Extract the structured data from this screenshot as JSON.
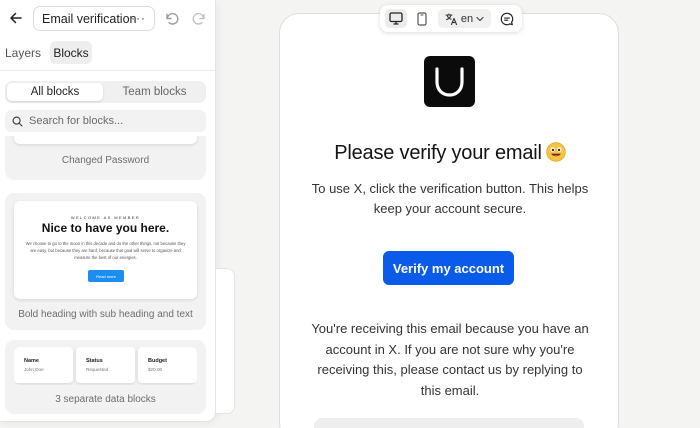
{
  "editor": {
    "document_title": "Email verification",
    "more_label": "···",
    "tabs": [
      "Layers",
      "Blocks"
    ],
    "active_tab": "Blocks",
    "block_filter": {
      "options": [
        "All blocks",
        "Team blocks"
      ],
      "selected": "All blocks"
    },
    "search": {
      "placeholder": "Search for blocks...",
      "value": ""
    },
    "blocks": [
      {
        "label": "Changed Password"
      },
      {
        "label": "Bold heading with sub heading and text",
        "preview": {
          "eyebrow": "WELCOME AS MEMBER",
          "heading": "Nice to have you here.",
          "text": "We choose to go to the moon in this decade and do the other things, not because they are easy, but because they are hard, because that goal will serve to organize and measure the best of our energies.",
          "button": "Read more"
        }
      },
      {
        "label": "3 separate data blocks",
        "preview": {
          "items": [
            {
              "title": "Name",
              "value": "John Doe"
            },
            {
              "title": "Status",
              "value": "Requested"
            },
            {
              "title": "Budget",
              "value": "$20.00"
            }
          ]
        }
      }
    ]
  },
  "preview_toolbar": {
    "language": "en",
    "devices": [
      "desktop",
      "mobile"
    ],
    "selected_device": "desktop",
    "icons": [
      "monitor-icon",
      "phone-icon",
      "translate-icon",
      "chevron-down-icon",
      "comment-icon"
    ]
  },
  "email": {
    "headline": "Please verify your email",
    "intro": "To use X, click the verification button. This helps keep your account secure.",
    "cta": "Verify my account",
    "footer": "You're receiving this email because you have an account in X. If you are not sure why you're receiving this, please contact us by replying to this email."
  },
  "colors": {
    "cta": "#0b5bea",
    "block_preview_accent": "#1d8ef0",
    "logo_background": "#0b0b0b"
  }
}
